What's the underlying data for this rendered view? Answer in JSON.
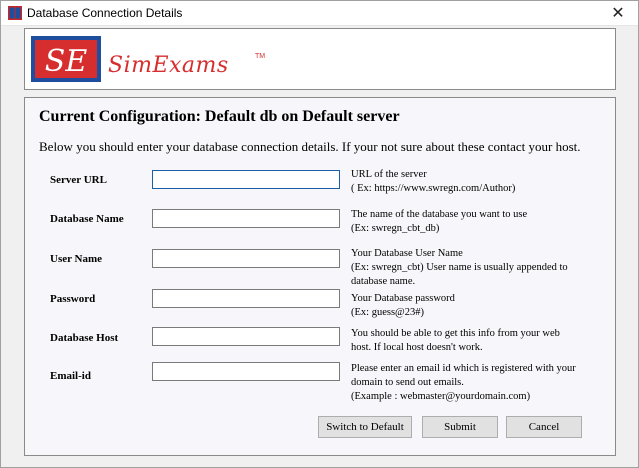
{
  "window": {
    "title": "Database Connection Details",
    "close_glyph": "✕"
  },
  "logo": {
    "mark": "SE",
    "word": "SimExams",
    "tm": "TM"
  },
  "config": {
    "heading": "Current Configuration: Default db on Default server",
    "intro": "Below you should enter your database connection details. If your not sure about these contact your host."
  },
  "fields": [
    {
      "label": "Server URL",
      "value": "",
      "help": [
        "URL of the server",
        " ( Ex: https://www.swregn.com/Author)"
      ]
    },
    {
      "label": "Database Name",
      "value": "",
      "help": [
        "The name of the database you want to use",
        "(Ex: swregn_cbt_db)"
      ]
    },
    {
      "label": "User Name",
      "value": "",
      "help": [
        "Your Database User Name",
        "(Ex: swregn_cbt) User name is usually appended to",
        "database name."
      ]
    },
    {
      "label": "Password",
      "value": "",
      "help": [
        "Your Database password",
        "(Ex: guess@23#)"
      ]
    },
    {
      "label": "Database Host",
      "value": "",
      "help": [
        "You should be able to get this info from your web",
        "host. If local host doesn't work."
      ]
    },
    {
      "label": "Email-id",
      "value": "",
      "help": [
        "Please enter an email id which is registered with your",
        "domain to send out emails.",
        "(Example : webmaster@yourdomain.com)"
      ]
    }
  ],
  "buttons": {
    "switch_default": "Switch to Default",
    "submit": "Submit",
    "cancel": "Cancel"
  },
  "colors": {
    "logo_red": "#d62e2e",
    "logo_blue": "#1f4e9e",
    "focus_border": "#1a5fa8"
  }
}
